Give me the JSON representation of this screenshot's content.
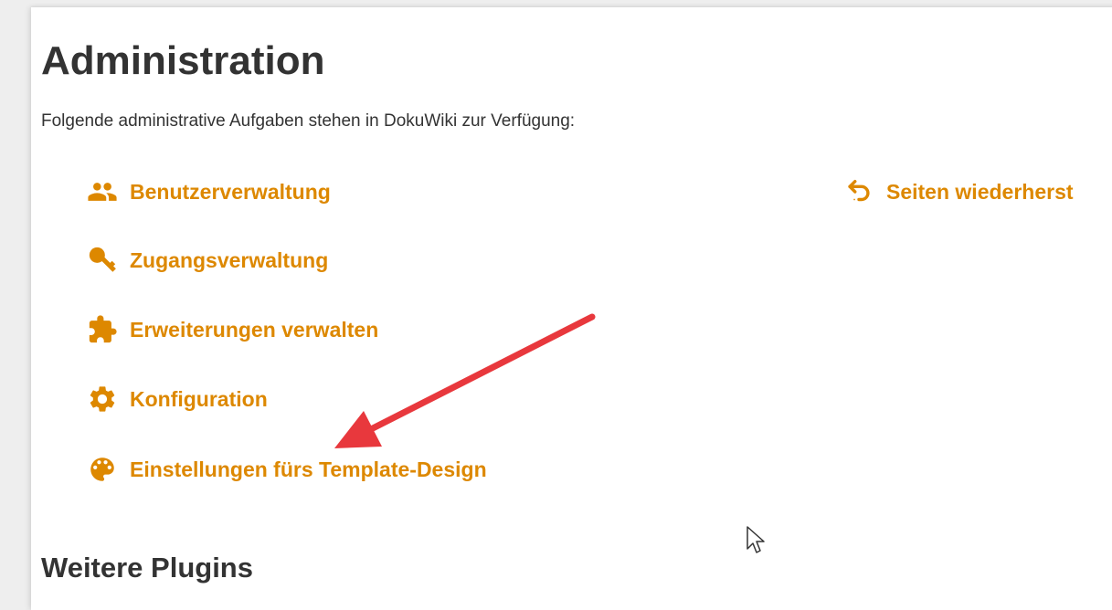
{
  "page": {
    "title": "Administration",
    "intro": "Folgende administrative Aufgaben stehen in DokuWiki zur Verfügung:"
  },
  "admin_links": [
    {
      "label": "Benutzerverwaltung",
      "icon": "users-icon"
    },
    {
      "label": "Zugangsverwaltung",
      "icon": "key-icon"
    },
    {
      "label": "Erweiterungen verwalten",
      "icon": "puzzle-icon"
    },
    {
      "label": "Konfiguration",
      "icon": "gear-icon"
    },
    {
      "label": "Einstellungen fürs Template-Design",
      "icon": "palette-icon"
    }
  ],
  "right_links": [
    {
      "label": "Seiten wiederherst",
      "icon": "undo-icon"
    }
  ],
  "section": {
    "title": "Weitere Plugins"
  },
  "colors": {
    "link": "#dd8800",
    "text": "#333333",
    "annotation_arrow": "#e8383d"
  }
}
